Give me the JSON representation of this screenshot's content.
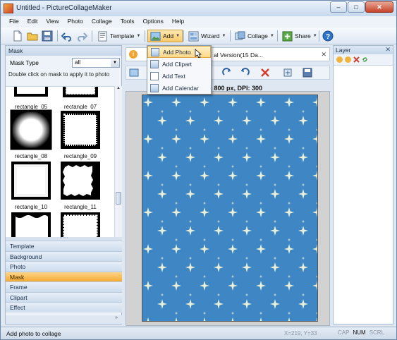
{
  "window": {
    "title": "Untitled - PictureCollageMaker",
    "min": "–",
    "max": "□",
    "close": "✕"
  },
  "menu": [
    "File",
    "Edit",
    "View",
    "Photo",
    "Collage",
    "Tools",
    "Options",
    "Help"
  ],
  "toolbar": {
    "template": "Template",
    "add": "Add",
    "wizard": "Wizard",
    "collage": "Collage",
    "share": "Share"
  },
  "left_panel": {
    "title": "Mask",
    "mask_type_label": "Mask Type",
    "mask_type_value": "all",
    "hint": "Double click on mask to apply it to photo",
    "masks": [
      "rectangle_05",
      "rectangle_07",
      "rectangle_08",
      "rectangle_09",
      "rectangle_10",
      "rectangle_11"
    ],
    "sections": [
      "Template",
      "Background",
      "Photo",
      "Mask",
      "Frame",
      "Clipart",
      "Effect"
    ],
    "active_section": "Mask",
    "footer": "»"
  },
  "document": {
    "info_text": "al Version(15 Da...",
    "caption": "x 800 px, DPI: 300",
    "info_close": "✕"
  },
  "dropdown": {
    "items": [
      "Add Photo",
      "Add Clipart",
      "Add Text",
      "Add Calendar"
    ],
    "hovered": "Add Photo"
  },
  "right_panel": {
    "title": "Layer",
    "close": "✕"
  },
  "status": {
    "message": "Add photo to collage",
    "coords": "X=219, Y=33",
    "keys": [
      "CAP",
      "NUM",
      "SCRL"
    ],
    "active_key": "NUM"
  },
  "colors": {
    "canvas_blue": "#3f86c5",
    "active_section": "#f5a930",
    "hover_item": "#ffd98a"
  }
}
